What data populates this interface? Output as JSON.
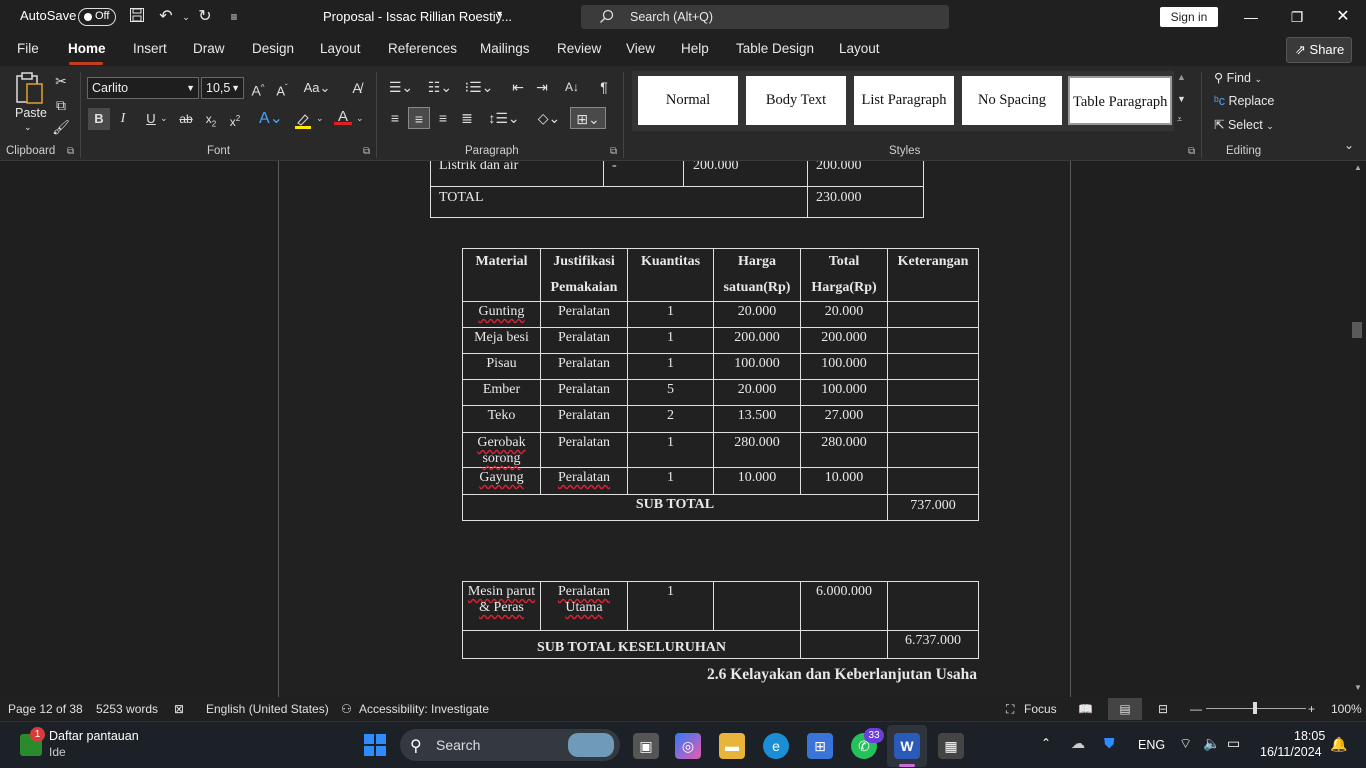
{
  "titlebar": {
    "autosave_label": "AutoSave",
    "autosave_state": "Off",
    "doc_title": "Proposal - Issac Rillian Roestiy...",
    "search_placeholder": "Search (Alt+Q)",
    "signin": "Sign in"
  },
  "tabs": [
    "File",
    "Home",
    "Insert",
    "Draw",
    "Design",
    "Layout",
    "References",
    "Mailings",
    "Review",
    "View",
    "Help",
    "Table Design",
    "Layout"
  ],
  "active_tab": "Home",
  "share_label": "Share",
  "ribbon": {
    "clipboard": {
      "paste": "Paste",
      "label": "Clipboard"
    },
    "font": {
      "family": "Carlito",
      "size": "10,5",
      "label": "Font"
    },
    "paragraph": {
      "label": "Paragraph"
    },
    "styles": {
      "label": "Styles",
      "items": [
        "Normal",
        "Body Text",
        "List Paragraph",
        "No Spacing",
        "Table Paragraph"
      ],
      "selected": "Table Paragraph"
    },
    "editing": {
      "label": "Editing",
      "find": "Find",
      "replace": "Replace",
      "select": "Select"
    }
  },
  "doc": {
    "top_table": {
      "row1": [
        "Listrik dan air",
        "-",
        "200.000",
        "200.000"
      ],
      "total_label": "TOTAL",
      "total_value": "230.000"
    },
    "material_table": {
      "headers": [
        [
          "Material"
        ],
        [
          "Justifikasi",
          "Pemakaian"
        ],
        [
          "Kuantitas"
        ],
        [
          "Harga",
          "satuan(Rp)"
        ],
        [
          "Total",
          "Harga(Rp)"
        ],
        [
          "Keterangan"
        ]
      ],
      "rows": [
        [
          "Gunting",
          "Peralatan",
          "1",
          "20.000",
          "20.000",
          ""
        ],
        [
          "Meja besi",
          "Peralatan",
          "1",
          "200.000",
          "200.000",
          ""
        ],
        [
          "Pisau",
          "Peralatan",
          "1",
          "100.000",
          "100.000",
          ""
        ],
        [
          "Ember",
          "Peralatan",
          "5",
          "20.000",
          "100.000",
          ""
        ],
        [
          "Teko",
          "Peralatan",
          "2",
          "13.500",
          "27.000",
          ""
        ],
        [
          "Gerobak sorong",
          "Peralatan",
          "1",
          "280.000",
          "280.000",
          ""
        ],
        [
          "Gayung",
          "Peralatan",
          "1",
          "10.000",
          "10.000",
          ""
        ]
      ],
      "subtotal_label": "SUB TOTAL",
      "subtotal_value": "737.000"
    },
    "machine_table": {
      "row": [
        "Mesin parut & Peras",
        "Peralatan Utama",
        "1",
        "",
        "6.000.000",
        ""
      ],
      "grand_label": "SUB TOTAL KESELURUHAN",
      "grand_value": "6.737.000"
    },
    "heading": "2.6 Kelayakan dan Keberlanjutan Usaha"
  },
  "statusbar": {
    "page": "Page 12 of 38",
    "words": "5253 words",
    "language": "English (United States)",
    "accessibility": "Accessibility: Investigate",
    "focus": "Focus",
    "zoom": "100%"
  },
  "taskbar": {
    "widget_title": "Daftar pantauan",
    "widget_sub": "Ide",
    "widget_badge": "1",
    "search": "Search",
    "whatsapp_badge": "33",
    "lang": "ENG",
    "time": "18:05",
    "date": "16/11/2024"
  }
}
